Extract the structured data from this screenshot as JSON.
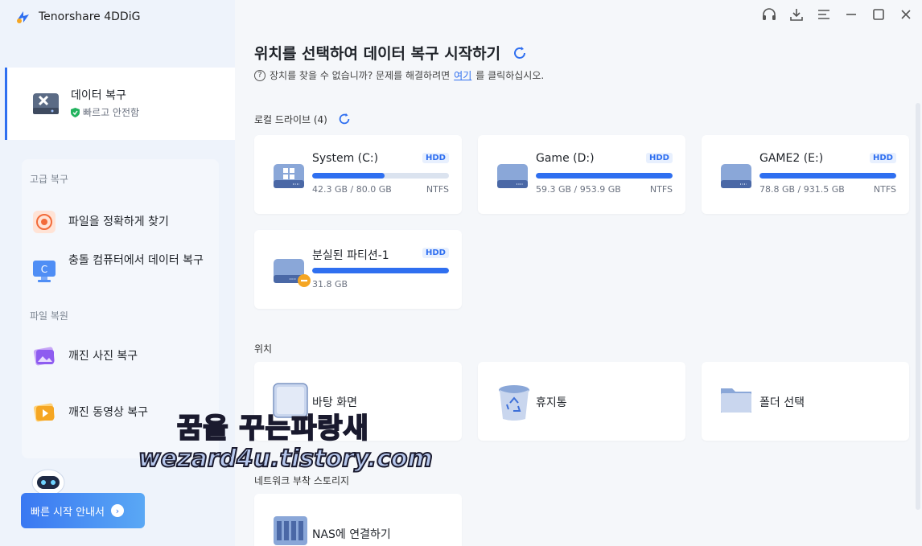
{
  "app": {
    "title": "Tenorshare 4DDiG"
  },
  "sidebar": {
    "main_item": {
      "title": "데이터 복구",
      "subtitle": "빠르고 안전함"
    },
    "advanced_label": "고급 복구",
    "advanced_items": [
      {
        "label": "파일을 정확하게 찾기"
      },
      {
        "label": "충돌 컴퓨터에서 데이터 복구"
      }
    ],
    "file_repair_label": "파일 복원",
    "repair_items": [
      {
        "label": "깨진 사진 복구"
      },
      {
        "label": "깨진 동영상 복구"
      }
    ],
    "quick_start": "빠른 시작 안내서"
  },
  "main": {
    "title": "위치를 선택하여 데이터 복구 시작하기",
    "hint_prefix": "장치를 찾을 수 없습니까? 문제를 해결하려면 ",
    "hint_link": "여기",
    "hint_suffix": "를 클릭하십시오.",
    "local_drives_label": "로컬 드라이브 (4)",
    "drives": [
      {
        "name": "System (C:)",
        "badge": "HDD",
        "used": "42.3 GB / 80.0 GB",
        "fs": "NTFS",
        "fill": 0.53
      },
      {
        "name": "Game (D:)",
        "badge": "HDD",
        "used": "59.3 GB / 953.9 GB",
        "fs": "NTFS",
        "fill": 1.0
      },
      {
        "name": "GAME2 (E:)",
        "badge": "HDD",
        "used": "78.8 GB / 931.5 GB",
        "fs": "NTFS",
        "fill": 1.0
      },
      {
        "name": "분실된 파티션-1",
        "badge": "HDD",
        "used": "31.8 GB",
        "fs": "",
        "fill": 1.0
      }
    ],
    "location_label": "위치",
    "locations": [
      {
        "name": "바탕 화면"
      },
      {
        "name": "휴지통"
      },
      {
        "name": "폴더 선택"
      }
    ],
    "nas_label": "네트워크 부착 스토리지",
    "nas": [
      {
        "name": "NAS에 연결하기"
      }
    ]
  },
  "watermark": {
    "line1": "꿈을 꾸는파랑새",
    "line2": "wezard4u.tistory.com"
  },
  "colors": {
    "accent": "#2f6ff0",
    "sidebar_bg": "#eef3fb",
    "main_bg": "#f5f7fa",
    "warning": "#f5a623"
  }
}
